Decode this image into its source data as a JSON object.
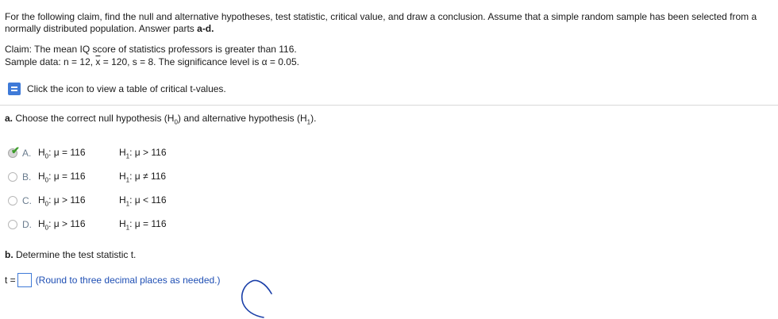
{
  "intro": {
    "text": "For the following claim, find the null and alternative hypotheses, test statistic, critical value, and draw a conclusion. Assume that a simple random sample has been selected from a normally distributed population. Answer parts ",
    "bold": "a-d."
  },
  "claim": "Claim: The mean IQ score of statistics professors is greater than 116.",
  "sample": {
    "prefix": "Sample data: n = 12, ",
    "xbar": "x",
    "rest": " = 120, s = 8. The significance level is α = 0.05."
  },
  "tool_link": "Click the icon to view a table of critical t-values.",
  "part_a": {
    "prefix": "a.",
    "text_1": " Choose the correct null hypothesis (H",
    "sub_0": "0",
    "text_2": ") and alternative hypothesis (H",
    "sub_1": "1",
    "text_3": ")."
  },
  "options": [
    {
      "letter": "A.",
      "h0_rel": ": μ = 116",
      "h1_rel": ": μ > 116",
      "selected": true
    },
    {
      "letter": "B.",
      "h0_rel": ": μ = 116",
      "h1_rel": ": μ ≠ 116",
      "selected": false
    },
    {
      "letter": "C.",
      "h0_rel": ": μ > 116",
      "h1_rel": ": μ < 116",
      "selected": false
    },
    {
      "letter": "D.",
      "h0_rel": ": μ > 116",
      "h1_rel": ": μ = 116",
      "selected": false
    }
  ],
  "h_labels": {
    "h": "H",
    "s0": "0",
    "s1": "1"
  },
  "part_b": {
    "prefix": "b.",
    "text": " Determine the test statistic t."
  },
  "t_input": {
    "label": "t =",
    "value": "",
    "hint": "(Round to three decimal places as needed.)"
  },
  "colors": {
    "accent": "#3f7ad8",
    "hint": "#1f4fb4",
    "check": "#3c9b2a"
  }
}
